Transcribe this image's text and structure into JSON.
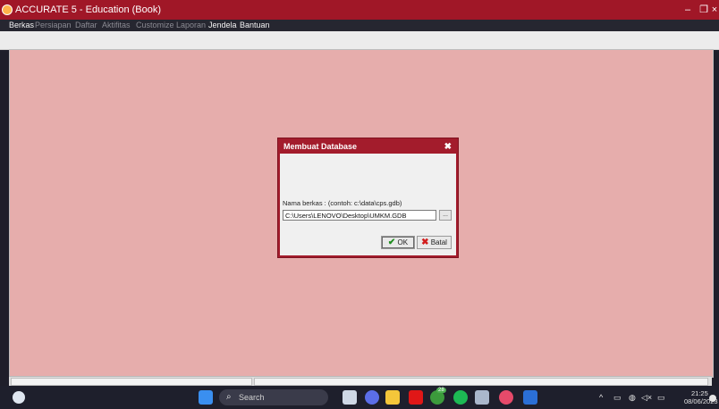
{
  "window": {
    "title": "ACCURATE 5 - Education (Book)",
    "minimize_glyph": "–",
    "restore_glyph": "❐",
    "close_glyph": "×"
  },
  "menu": [
    {
      "label": "Berkas",
      "enabled": true
    },
    {
      "label": "Persiapan",
      "enabled": false
    },
    {
      "label": "Daftar",
      "enabled": false
    },
    {
      "label": "Aktifitas",
      "enabled": false
    },
    {
      "label": "Customize",
      "enabled": false
    },
    {
      "label": "Laporan",
      "enabled": false
    },
    {
      "label": "Jendela",
      "enabled": true
    },
    {
      "label": "Bantuan",
      "enabled": true
    }
  ],
  "dialog": {
    "title": "Membuat Database",
    "close_glyph": "✖",
    "file_label": "Nama berkas : (contoh: c:\\data\\cps.gdb)",
    "file_value": "C:\\Users\\LENOVO\\Desktop\\UMKM.GDB",
    "browse_label": "...",
    "ok_label": "OK",
    "cancel_label": "Batal"
  },
  "taskbar": {
    "search_placeholder": "Search",
    "time": "21:25",
    "date": "08/06/2023",
    "chat_badge": "28"
  },
  "colors": {
    "titlebar": "#a01727",
    "workspace": "#e6adac",
    "dialog_border": "#a31c2c",
    "taskbar": "#1e1f2c"
  }
}
